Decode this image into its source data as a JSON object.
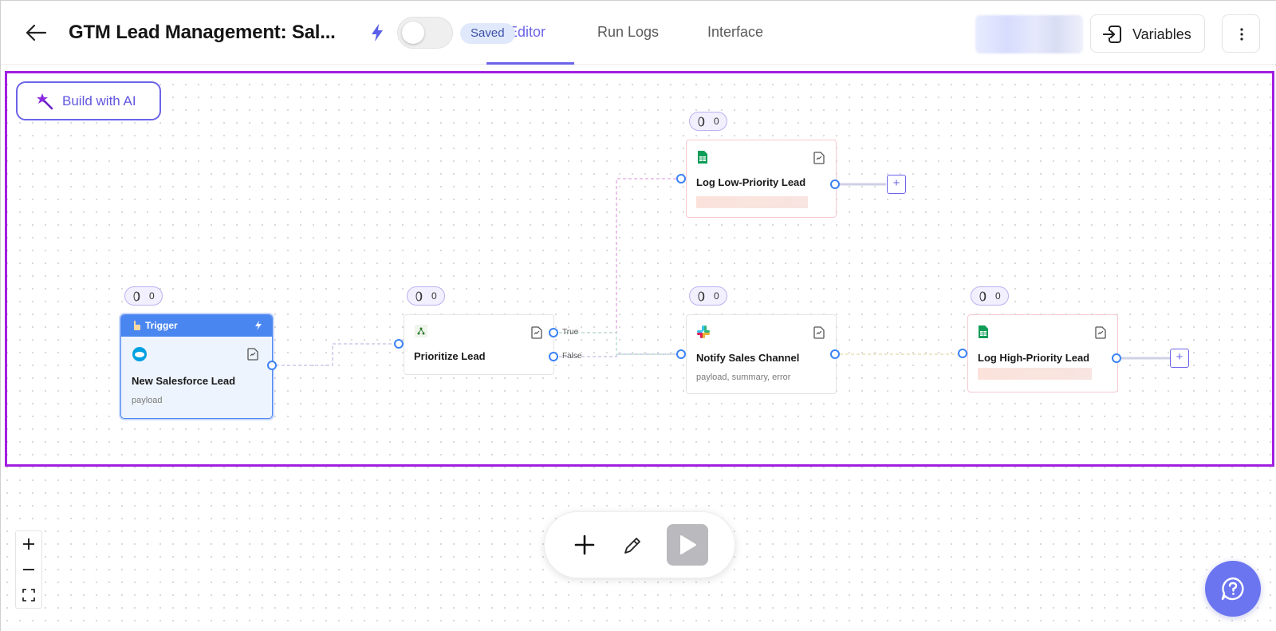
{
  "header": {
    "title": "GTM Lead Management: Sal...",
    "saved_label": "Saved",
    "tabs": [
      {
        "label": "Editor",
        "active": true
      },
      {
        "label": "Run Logs",
        "active": false
      },
      {
        "label": "Interface",
        "active": false
      }
    ],
    "variables_label": "Variables",
    "accent_color": "#6b63e8"
  },
  "canvas": {
    "build_with_ai_label": "Build with AI",
    "selection_color": "#a11fe0"
  },
  "nodes": {
    "trigger": {
      "header_label": "Trigger",
      "name": "New Salesforce Lead",
      "outputs": "payload",
      "count": "0",
      "icon": "salesforce-cloud-icon"
    },
    "prioritize": {
      "name": "Prioritize Lead",
      "count": "0",
      "branch_true": "True",
      "branch_false": "False",
      "icon": "branch-icon"
    },
    "low_priority": {
      "name": "Log Low-Priority Lead",
      "count": "0",
      "icon": "google-sheets-icon"
    },
    "notify": {
      "name": "Notify Sales Channel",
      "outputs": "payload, summary, error",
      "count": "0",
      "icon": "slack-icon"
    },
    "high_priority": {
      "name": "Log High-Priority Lead",
      "count": "0",
      "icon": "google-sheets-icon"
    }
  },
  "toolbar": {
    "add_icon": "plus-icon",
    "edit_icon": "pen-icon",
    "run_icon": "play-icon"
  },
  "zoom": {
    "zoom_in": "+",
    "zoom_out": "−"
  },
  "help": {
    "icon": "help-chat-icon"
  }
}
